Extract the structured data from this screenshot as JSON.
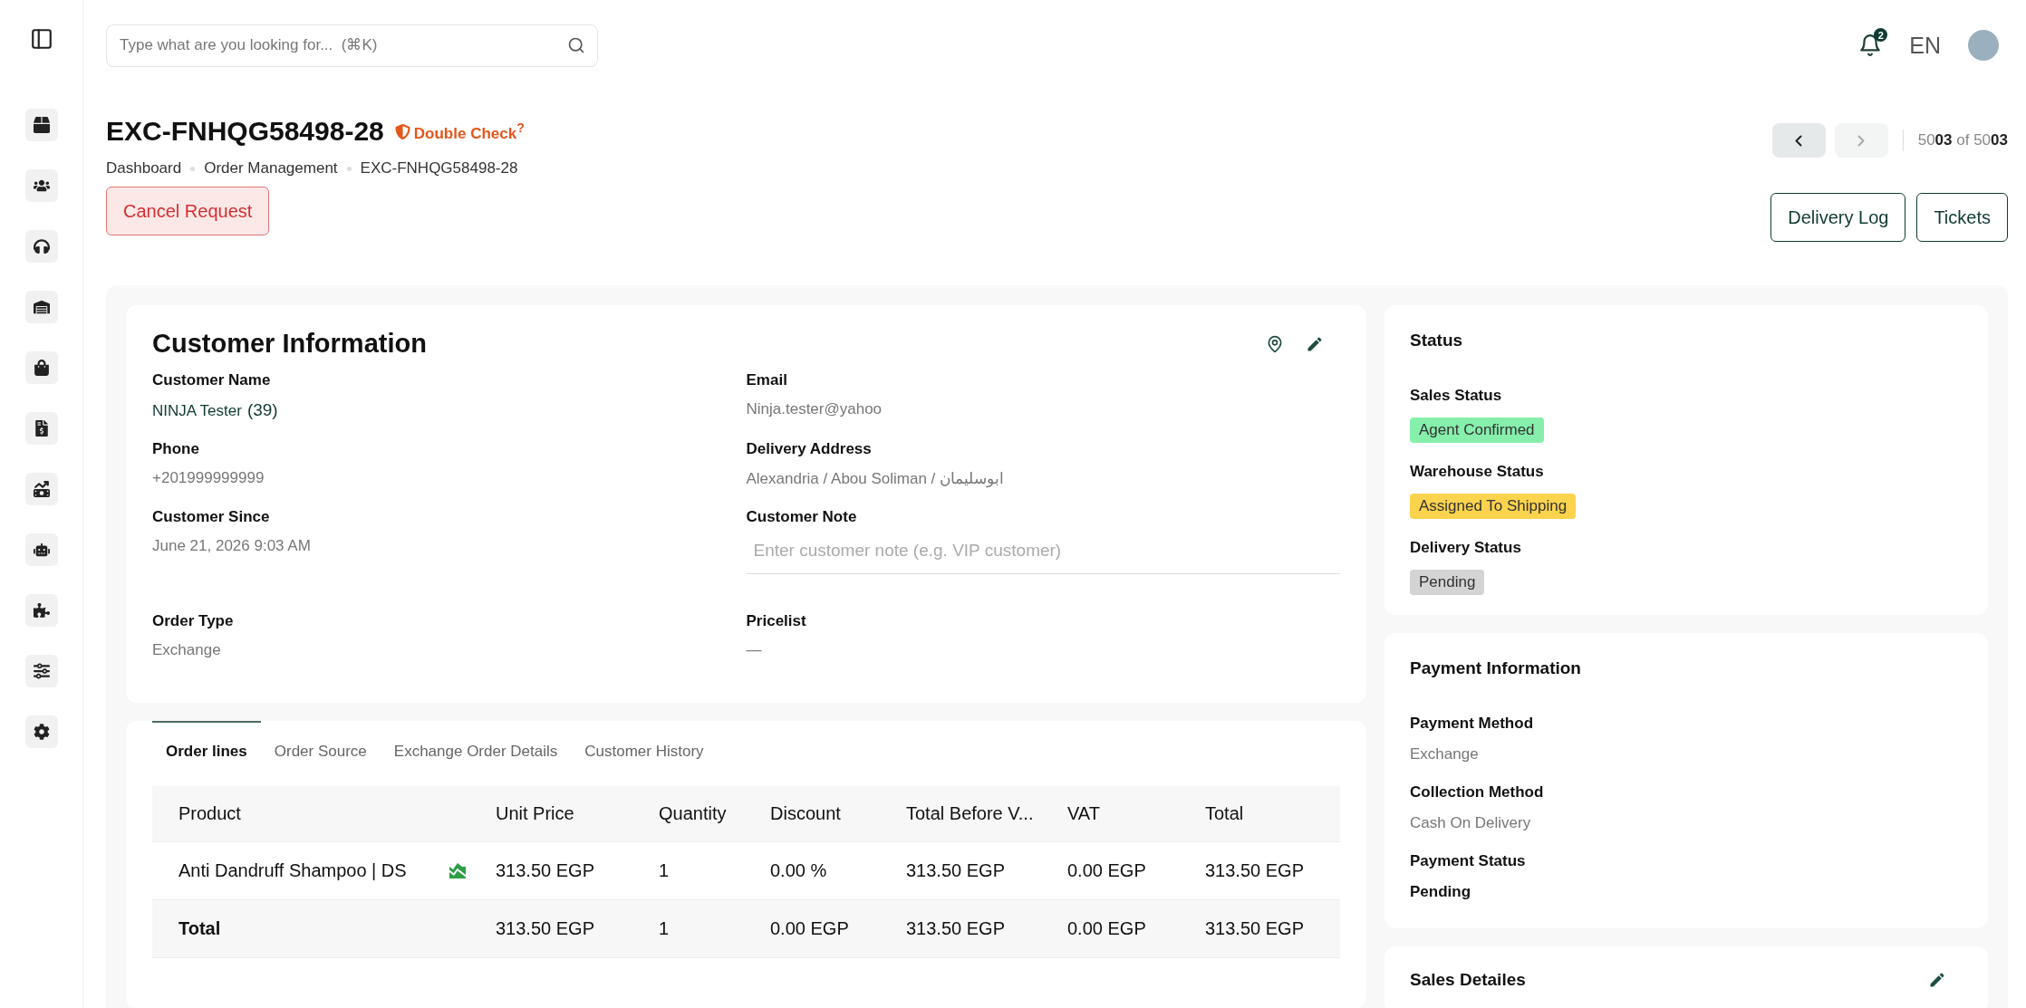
{
  "search": {
    "placeholder": "Type what are you looking for...  (⌘K)"
  },
  "header": {
    "notification_count": "2",
    "language": "EN"
  },
  "page": {
    "title": "EXC-FNHQG58498-28",
    "flag": "Double Check$^{?}$",
    "breadcrumbs": [
      "Dashboard",
      "Order Management",
      "EXC-FNHQG58498-28"
    ],
    "cancel_button": "Cancel Request",
    "pager": {
      "prev_disabled": false,
      "next_disabled": true,
      "counter": "50**03** of 50**03**"
    },
    "actions": [
      "Delivery Log",
      "Tickets"
    ]
  },
  "customer": {
    "title": "Customer Information",
    "fields": [
      {
        "label": "Customer Name",
        "value": "NINJA Tester",
        "count": "(39)",
        "kind": "link"
      },
      {
        "label": "Email",
        "value": "Ninja.tester@yahoo",
        "kind": "text"
      },
      {
        "label": "Phone",
        "value": "+201999999999",
        "kind": "text"
      },
      {
        "label": "Delivery Address",
        "value": "Alexandria / Abou Soliman / ابوسليمان",
        "kind": "text"
      },
      {
        "label": "Customer Since",
        "value": "June 21, 2026 9:03 AM",
        "kind": "text"
      },
      {
        "label": "Customer Note",
        "placeholder": "Enter customer note (e.g. VIP customer)",
        "kind": "input"
      },
      {
        "label": "Order Type",
        "value": "Exchange",
        "kind": "text"
      },
      {
        "label": "Pricelist",
        "value": "—",
        "kind": "text"
      }
    ]
  },
  "tabs": [
    {
      "label": "Order lines",
      "selected": true
    },
    {
      "label": "Order Source",
      "selected": false
    },
    {
      "label": "Exchange Order Details",
      "selected": false
    },
    {
      "label": "Customer History",
      "selected": false
    }
  ],
  "table": {
    "columns": [
      "Product",
      "Unit Price",
      "Quantity",
      "Discount",
      "Total Before V...",
      "VAT",
      "Total"
    ],
    "rows": [
      {
        "kind": "item",
        "cells": [
          "Anti Dandruff Shampoo | DS",
          "313.50 EGP",
          "1",
          "0.00 %",
          "313.50 EGP",
          "0.00 EGP",
          "313.50 EGP"
        ]
      },
      {
        "kind": "total",
        "cells": [
          "Total",
          "313.50 EGP",
          "1",
          "0.00 EGP",
          "313.50 EGP",
          "0.00 EGP",
          "313.50 EGP"
        ]
      }
    ]
  },
  "status": {
    "title": "Status",
    "items": [
      {
        "label": "Sales Status",
        "value": "Agent Confirmed",
        "color": "#86efac"
      },
      {
        "label": "Warehouse Status",
        "value": "Assigned To Shipping",
        "color": "#fcd34d"
      },
      {
        "label": "Delivery Status",
        "value": "Pending",
        "color": "#d4d4d4"
      }
    ]
  },
  "payment": {
    "title": "Payment Information",
    "items": [
      {
        "label": "Payment Method",
        "value": "Exchange",
        "muted": true
      },
      {
        "label": "Collection Method",
        "value": "Cash On Delivery",
        "muted": true
      },
      {
        "label": "Payment Status",
        "value": "Pending",
        "muted": false
      }
    ]
  },
  "sales": {
    "title": "Sales Detailes"
  }
}
